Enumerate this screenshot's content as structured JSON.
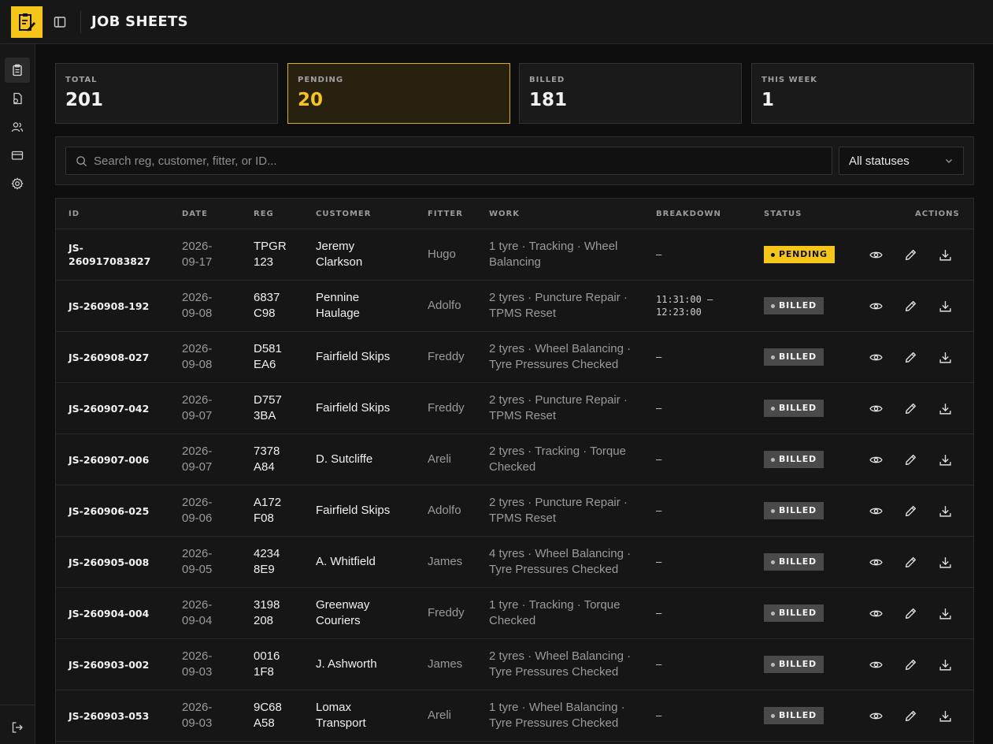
{
  "header": {
    "title": "JOB SHEETS"
  },
  "nav": {
    "items": [
      {
        "name": "job-sheets",
        "icon": "clipboard-icon",
        "active": true
      },
      {
        "name": "invoices",
        "icon": "file-icon",
        "active": false
      },
      {
        "name": "customers",
        "icon": "users-icon",
        "active": false
      },
      {
        "name": "billing",
        "icon": "credit-card-icon",
        "active": false
      },
      {
        "name": "settings",
        "icon": "gear-icon",
        "active": false
      }
    ],
    "logout_icon": "logout-icon"
  },
  "stats": {
    "total": {
      "label": "TOTAL",
      "value": "201"
    },
    "pending": {
      "label": "PENDING",
      "value": "20"
    },
    "billed": {
      "label": "BILLED",
      "value": "181"
    },
    "this_week": {
      "label": "THIS WEEK",
      "value": "1"
    }
  },
  "filters": {
    "search_placeholder": "Search reg, customer, fitter, or ID...",
    "search_value": "",
    "status_selected": "All statuses"
  },
  "table": {
    "headers": {
      "id": "ID",
      "date": "DATE",
      "reg": "REG",
      "customer": "CUSTOMER",
      "fitter": "FITTER",
      "work": "WORK",
      "breakdown": "BREAKDOWN",
      "status": "STATUS",
      "actions": "ACTIONS"
    },
    "rows": [
      {
        "id": "JS-\n260917083827",
        "date": "2026-\n09-17",
        "reg": "TPGR\n123",
        "customer": "Jeremy\nClarkson",
        "fitter": "Hugo",
        "work": "1 tyre · Tracking · Wheel Balancing",
        "breakdown": "–",
        "status": "PENDING"
      },
      {
        "id": "JS-260908-192",
        "date": "2026-\n09-08",
        "reg": "6837\nC98",
        "customer": "Pennine\nHaulage",
        "fitter": "Adolfo",
        "work": "2 tyres · Puncture Repair · TPMS Reset",
        "breakdown": "11:31:00 –\n12:23:00",
        "status": "BILLED"
      },
      {
        "id": "JS-260908-027",
        "date": "2026-\n09-08",
        "reg": "D581\nEA6",
        "customer": "Fairfield Skips",
        "fitter": "Freddy",
        "work": "2 tyres · Wheel Balancing · Tyre Pressures Checked",
        "breakdown": "–",
        "status": "BILLED"
      },
      {
        "id": "JS-260907-042",
        "date": "2026-\n09-07",
        "reg": "D757\n3BA",
        "customer": "Fairfield Skips",
        "fitter": "Freddy",
        "work": "2 tyres · Puncture Repair · TPMS Reset",
        "breakdown": "–",
        "status": "BILLED"
      },
      {
        "id": "JS-260907-006",
        "date": "2026-\n09-07",
        "reg": "7378\nA84",
        "customer": "D. Sutcliffe",
        "fitter": "Areli",
        "work": "2 tyres · Tracking · Torque Checked",
        "breakdown": "–",
        "status": "BILLED"
      },
      {
        "id": "JS-260906-025",
        "date": "2026-\n09-06",
        "reg": "A172\nF08",
        "customer": "Fairfield Skips",
        "fitter": "Adolfo",
        "work": "2 tyres · Puncture Repair · TPMS Reset",
        "breakdown": "–",
        "status": "BILLED"
      },
      {
        "id": "JS-260905-008",
        "date": "2026-\n09-05",
        "reg": "4234\n8E9",
        "customer": "A. Whitfield",
        "fitter": "James",
        "work": "4 tyres · Wheel Balancing · Tyre Pressures Checked",
        "breakdown": "–",
        "status": "BILLED"
      },
      {
        "id": "JS-260904-004",
        "date": "2026-\n09-04",
        "reg": "3198\n208",
        "customer": "Greenway\nCouriers",
        "fitter": "Freddy",
        "work": "1 tyre · Tracking · Torque Checked",
        "breakdown": "–",
        "status": "BILLED"
      },
      {
        "id": "JS-260903-002",
        "date": "2026-\n09-03",
        "reg": "0016\n1F8",
        "customer": "J. Ashworth",
        "fitter": "James",
        "work": "2 tyres · Wheel Balancing · Tyre Pressures Checked",
        "breakdown": "–",
        "status": "BILLED"
      },
      {
        "id": "JS-260903-053",
        "date": "2026-\n09-03",
        "reg": "9C68\nA58",
        "customer": "Lomax\nTransport",
        "fitter": "Areli",
        "work": "1 tyre · Wheel Balancing · Tyre Pressures Checked",
        "breakdown": "–",
        "status": "BILLED"
      }
    ]
  },
  "colors": {
    "accent": "#f5c518",
    "background": "#0e0e0e",
    "panel": "#1a1a1a",
    "billed_badge": "#4a4a4a"
  }
}
